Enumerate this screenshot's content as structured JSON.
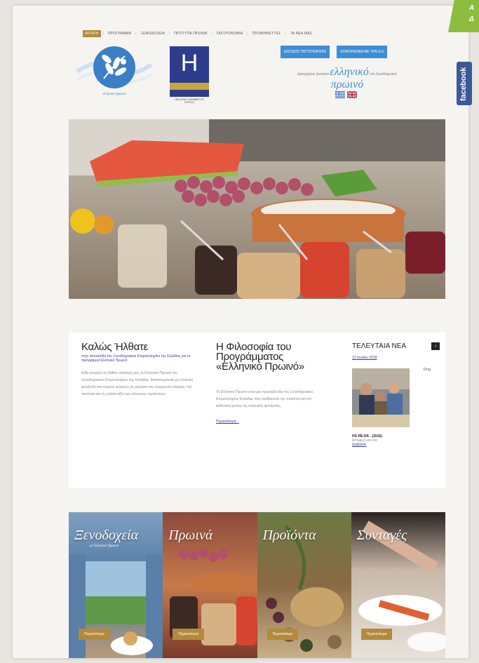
{
  "corner_badge": {
    "line1": "A",
    "line2": "Δ"
  },
  "facebook": {
    "label": "facebook"
  },
  "nav": {
    "items": [
      "ΑΡΧΙΚΗ",
      "ΠΡΟΓΡΑΜΜΑ",
      "ΞΕΝΟΔΟΧΕΙΑ",
      "ΠΡΟΤΥΠΑ ΠΡΩΙΝΑ",
      "ΓΑΣΤΡΟΝΟΜΙΑ",
      "ΠΡΟΜΗΘΕΥΤΕΣ",
      "ΤΑ ΝΕΑ ΜΑΣ"
    ]
  },
  "logos": {
    "greek_breakfast_caption": "ελληνικό πρωινό",
    "hotel_letter": "H",
    "hotel_caption": "HELLENIC CHAMBER OF HOTELS"
  },
  "header_buttons": {
    "login": "ΕΙΣΟΔΟΣ ΠΙΣΤΟΠΟΙΗΣΗΣ",
    "contact": "ΕΠΙΚΟΙΝΩΝΙΑ ΜΕ ΤΗΝ ΕΞΙ"
  },
  "tagline": {
    "pre": "Διατηρήστε ζωντανό",
    "big1": "ελληνικό",
    "mid": "στο ξενοδοχειακό",
    "big2": "πρωινό"
  },
  "welcome": {
    "title": "Καλώς Ήλθατε",
    "subtitle": "στην ιστοσελίδα του Ξενοδοχειακού Επιμελητηρίου της Ελλάδας για το πρόγραμμα Ελληνικό Πρωινό",
    "body": "Είδα γνωρίζει σε βάθος αποδοχή μας το Ελληνικό Πρωινό του Ξενοδοχειακού Επιμελητηρίου της Ελλάδας. Ανταποκρίνεται με ελληνική φιλοξενία στο κείμενο γεύσεων σε ρεύματα του σύγχρονου κόσμου, την ποιότητα και τη γνήσια αξία των ελληνικών προϊόντων."
  },
  "philosophy": {
    "title": "Η Φιλοσοφία του Προγράμματος «Ελληνικό Πρωινό»",
    "body": "Το Ελληνικό Πρωινό είναι μια πρωτοβουλία του Ξενοδοχειακού Επιμελητηρίου Ελλάδας που αναδεικνύει την ποιότητα και την αυθεντική γεύση της ελληνικής φιλοξενίας.",
    "more": "Περισσότερα..."
  },
  "news": {
    "heading": "ΤΕΛΕΥΤΑΙΑ ΝΕΑ",
    "arrow": "›",
    "date": "12 Ιουλίου 2018",
    "flag": "Fing",
    "item_title": "HS RE-DA - (2016)",
    "item_sub": "Απόψεις και νέα",
    "more": "Διαβάστε"
  },
  "categories": [
    {
      "title": "Ξενοδοχεία",
      "subtitle": "με Ελληνικό Πρωινό",
      "button": "Περισσότερα"
    },
    {
      "title": "Πρωινά",
      "subtitle": "",
      "button": "Περισσότερα"
    },
    {
      "title": "Προϊόντα",
      "subtitle": "",
      "button": "Περισσότερα"
    },
    {
      "title": "Συνταγές",
      "subtitle": "",
      "button": "Περισσότερα"
    }
  ]
}
